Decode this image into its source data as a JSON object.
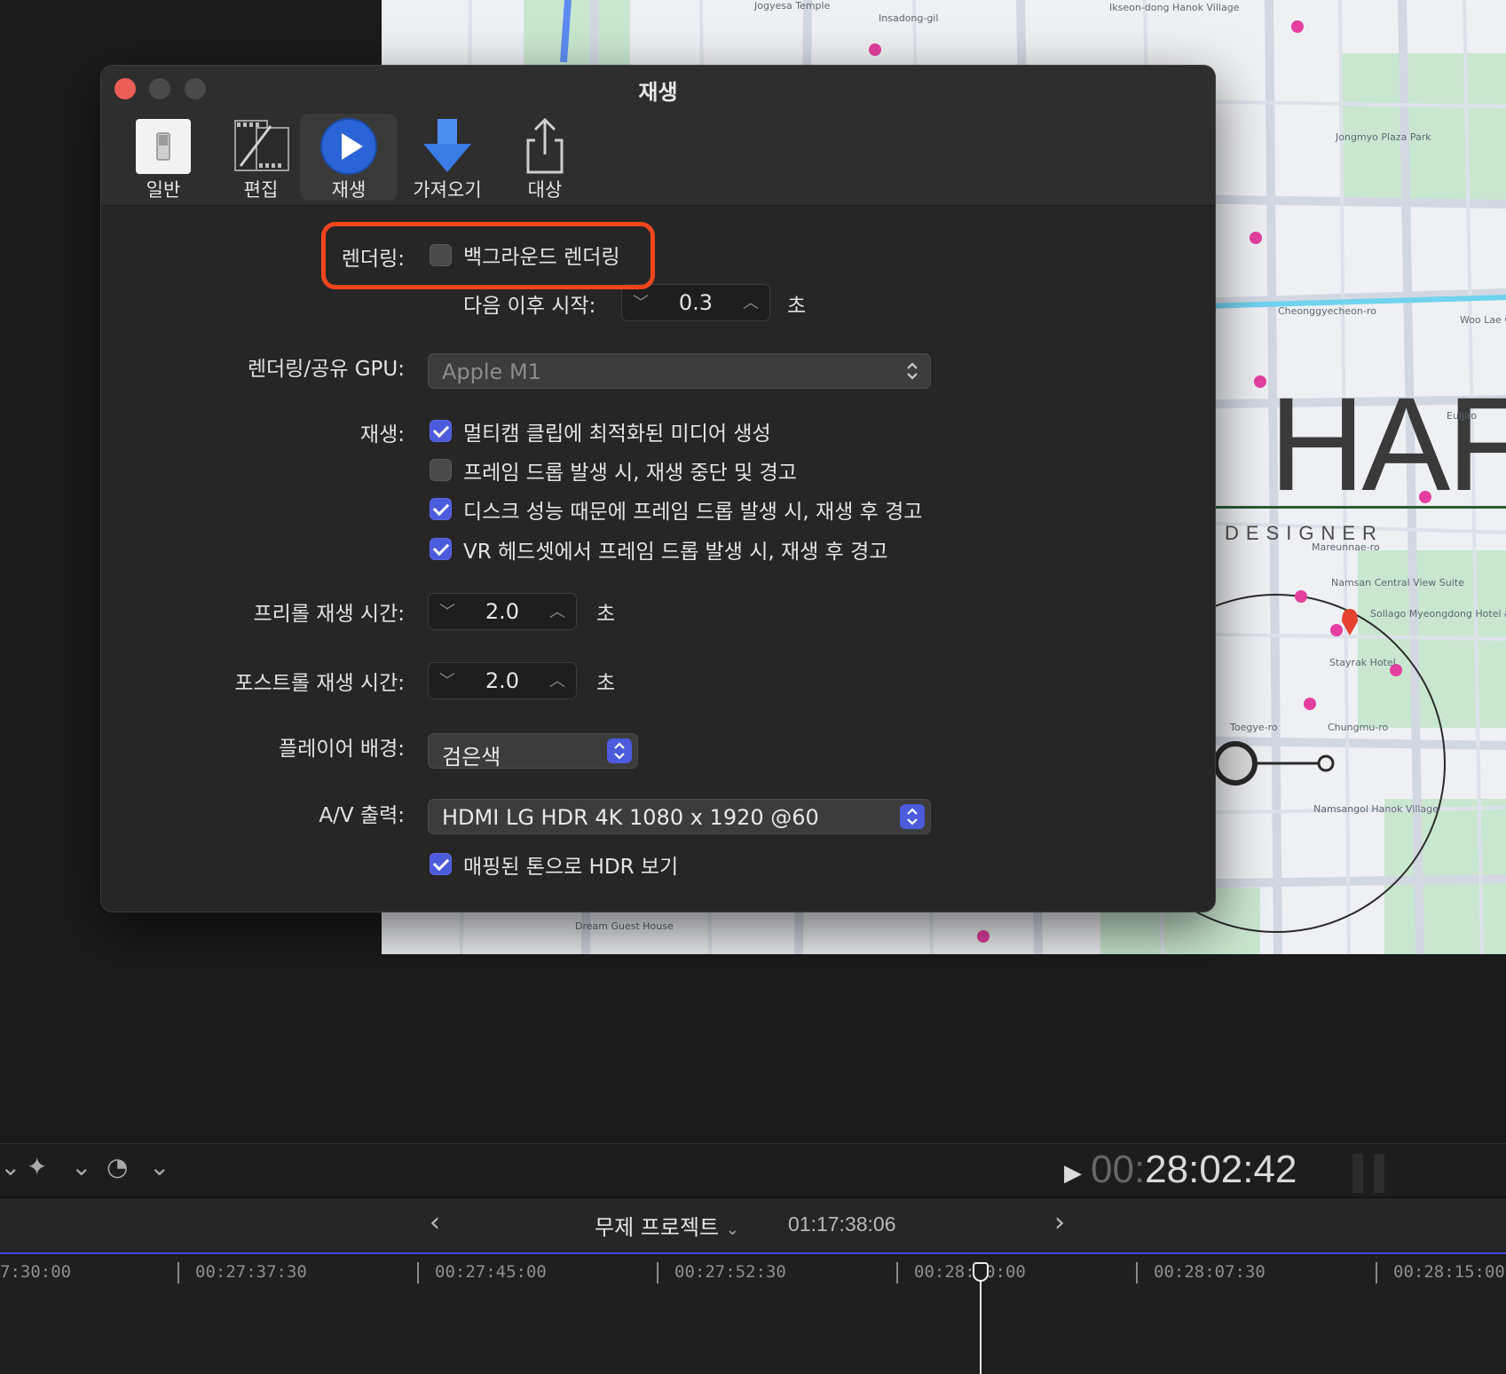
{
  "window": {
    "title": "재생",
    "tabs": [
      {
        "id": "general",
        "label": "일반",
        "icon": "general-switch-icon"
      },
      {
        "id": "editing",
        "label": "편집",
        "icon": "film-strip-icon"
      },
      {
        "id": "playback",
        "label": "재생",
        "icon": "play-circle-icon",
        "active": true
      },
      {
        "id": "import",
        "label": "가져오기",
        "icon": "download-arrow-icon"
      },
      {
        "id": "destinations",
        "label": "대상",
        "icon": "share-icon"
      }
    ]
  },
  "rendering": {
    "label": "렌더링:",
    "background_render_label": "백그라운드 렌더링",
    "background_render_checked": false,
    "start_after_label": "다음 이후 시작:",
    "start_after_value": "0.3",
    "start_after_unit": "초"
  },
  "gpu": {
    "label": "렌더링/공유 GPU:",
    "value": "Apple M1"
  },
  "playback": {
    "label": "재생:",
    "options": [
      {
        "label": "멀티캠 클립에 최적화된 미디어 생성",
        "checked": true
      },
      {
        "label": "프레임 드롭 발생 시, 재생 중단 및 경고",
        "checked": false
      },
      {
        "label": "디스크 성능 때문에 프레임 드롭 발생 시, 재생 후 경고",
        "checked": true
      },
      {
        "label": "VR 헤드셋에서 프레임 드롭 발생 시, 재생 후 경고",
        "checked": true
      }
    ]
  },
  "preroll": {
    "label": "프리롤 재생 시간:",
    "value": "2.0",
    "unit": "초"
  },
  "postroll": {
    "label": "포스트롤 재생 시간:",
    "value": "2.0",
    "unit": "초"
  },
  "player_background": {
    "label": "플레이어 배경:",
    "value": "검은색"
  },
  "av_output": {
    "label": "A/V 출력:",
    "value": "HDMI LG HDR 4K 1080 x 1920 @60",
    "hdr_tone_label": "매핑된 톤으로 HDR 보기",
    "hdr_tone_checked": true
  },
  "viewer": {
    "timecode_dim": "00:",
    "timecode_main": "28:02:42",
    "logo_text": "HAF",
    "logo_sub": "DESIGNER",
    "map_labels": [
      "Jongmyo Plaza Park",
      "Ikseon-dong Hanok Village",
      "Jogyesa Temple",
      "Insadong-gil",
      "Cheonggyecheon-ro",
      "Woo Lae Oak",
      "Namsan Central View Suite",
      "Sollago Myeongdong Hotel & Residence",
      "Stayrak Hotel",
      "Chungmu-ro",
      "Namsangol Hanok Village",
      "Dream Guest House",
      "Toegye-ro",
      "Mareunnae-ro",
      "Euljiro"
    ]
  },
  "timeline": {
    "project_name": "무제 프로젝트",
    "project_duration": "01:17:38:06",
    "ticks": [
      "7:30:00",
      "00:27:37:30",
      "00:27:45:00",
      "00:27:52:30",
      "00:28:00:00",
      "00:28:07:30",
      "00:28:15:00"
    ]
  },
  "colors": {
    "accent": "#4b5bdc",
    "highlight": "#f2451c",
    "close_button": "#ec5f56"
  }
}
